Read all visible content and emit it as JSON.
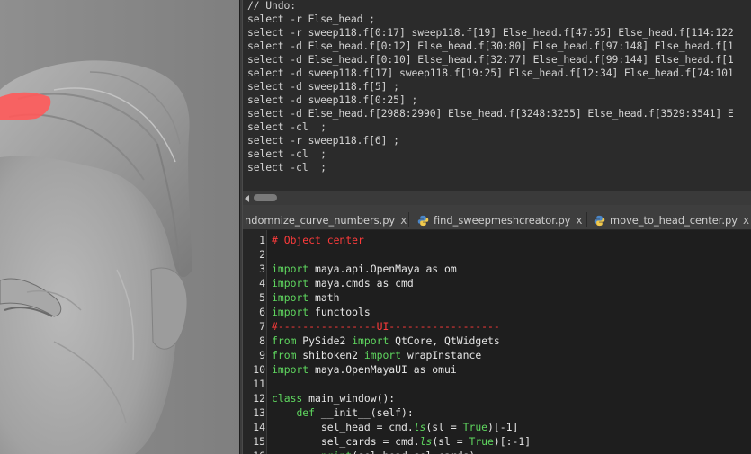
{
  "colors": {
    "code_keyword": "#5fd75f",
    "code_comment": "#ff3b3b",
    "code_text": "#e6e6e6",
    "history_text": "#d2d2d2",
    "viewport_bg": "#8a8a8a",
    "selection_highlight": "#ff5a5a"
  },
  "history": {
    "lines": [
      "// Undo:",
      "select -r Else_head ;",
      "select -r sweep118.f[0:17] sweep118.f[19] Else_head.f[47:55] Else_head.f[114:122",
      "select -d Else_head.f[0:12] Else_head.f[30:80] Else_head.f[97:148] Else_head.f[1",
      "select -d Else_head.f[0:10] Else_head.f[32:77] Else_head.f[99:144] Else_head.f[1",
      "select -d sweep118.f[17] sweep118.f[19:25] Else_head.f[12:34] Else_head.f[74:101",
      "select -d sweep118.f[5] ;",
      "select -d sweep118.f[0:25] ;",
      "select -d Else_head.f[2988:2990] Else_head.f[3248:3255] Else_head.f[3529:3541] E",
      "select -cl  ;",
      "select -r sweep118.f[6] ;",
      "select -cl  ;",
      "select -cl  ;"
    ]
  },
  "tabs": [
    {
      "label": "ndomnize_curve_numbers.py",
      "close": "x",
      "icon": "python-icon"
    },
    {
      "label": "find_sweepmeshcreator.py",
      "close": "x",
      "icon": "python-icon"
    },
    {
      "label": "move_to_head_center.py",
      "close": "x",
      "icon": "python-icon"
    }
  ],
  "editor": {
    "lines": [
      {
        "n": "1",
        "segments": [
          {
            "t": "# Object center",
            "c": "cm"
          }
        ]
      },
      {
        "n": "2",
        "segments": []
      },
      {
        "n": "3",
        "segments": [
          {
            "t": "import",
            "c": "kw"
          },
          {
            "t": " maya.api.OpenMaya as om",
            "c": ""
          }
        ]
      },
      {
        "n": "4",
        "segments": [
          {
            "t": "import",
            "c": "kw"
          },
          {
            "t": " maya.cmds as cmd",
            "c": ""
          }
        ]
      },
      {
        "n": "5",
        "segments": [
          {
            "t": "import",
            "c": "kw"
          },
          {
            "t": " math",
            "c": ""
          }
        ]
      },
      {
        "n": "6",
        "segments": [
          {
            "t": "import",
            "c": "kw"
          },
          {
            "t": " functools",
            "c": ""
          }
        ]
      },
      {
        "n": "7",
        "segments": [
          {
            "t": "#----------------UI------------------",
            "c": "cm"
          }
        ]
      },
      {
        "n": "8",
        "segments": [
          {
            "t": "from",
            "c": "kw"
          },
          {
            "t": " PySide2 ",
            "c": ""
          },
          {
            "t": "import",
            "c": "kw"
          },
          {
            "t": " QtCore, QtWidgets",
            "c": ""
          }
        ]
      },
      {
        "n": "9",
        "segments": [
          {
            "t": "from",
            "c": "kw"
          },
          {
            "t": " shiboken2 ",
            "c": ""
          },
          {
            "t": "import",
            "c": "kw"
          },
          {
            "t": " wrapInstance",
            "c": ""
          }
        ]
      },
      {
        "n": "10",
        "segments": [
          {
            "t": "import",
            "c": "kw"
          },
          {
            "t": " maya.OpenMayaUI as omui",
            "c": ""
          }
        ]
      },
      {
        "n": "11",
        "segments": []
      },
      {
        "n": "12",
        "segments": [
          {
            "t": "class",
            "c": "kw"
          },
          {
            "t": " main_window():",
            "c": ""
          }
        ]
      },
      {
        "n": "13",
        "segments": [
          {
            "t": "    ",
            "c": ""
          },
          {
            "t": "def",
            "c": "kw"
          },
          {
            "t": " __init__(self):",
            "c": ""
          }
        ]
      },
      {
        "n": "14",
        "segments": [
          {
            "t": "        sel_head = cmd.",
            "c": ""
          },
          {
            "t": "ls",
            "c": "fn"
          },
          {
            "t": "(sl = ",
            "c": ""
          },
          {
            "t": "True",
            "c": "kw"
          },
          {
            "t": ")[-1]",
            "c": ""
          }
        ]
      },
      {
        "n": "15",
        "segments": [
          {
            "t": "        sel_cards = cmd.",
            "c": ""
          },
          {
            "t": "ls",
            "c": "fn"
          },
          {
            "t": "(sl = ",
            "c": ""
          },
          {
            "t": "True",
            "c": "kw"
          },
          {
            "t": ")[:-1]",
            "c": ""
          }
        ]
      },
      {
        "n": "16",
        "segments": [
          {
            "t": "        ",
            "c": ""
          },
          {
            "t": "print",
            "c": "kw"
          },
          {
            "t": "(sel_head,sel_cards)",
            "c": ""
          }
        ]
      }
    ]
  }
}
